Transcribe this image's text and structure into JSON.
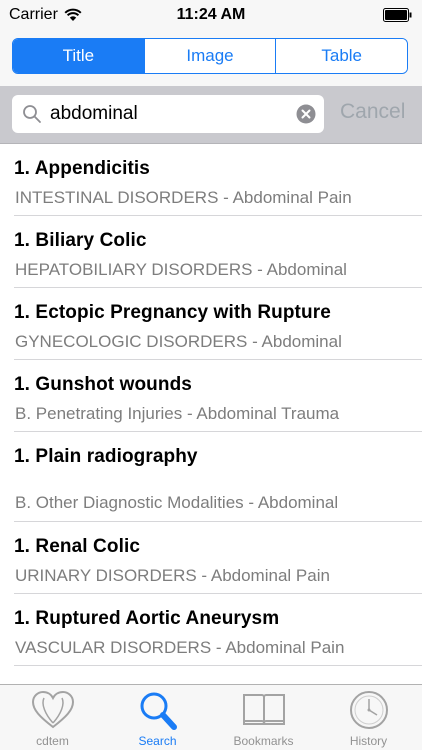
{
  "status_bar": {
    "carrier": "Carrier",
    "time": "11:24 AM"
  },
  "segments": {
    "title": "Title",
    "image": "Image",
    "table": "Table",
    "selected": "Title"
  },
  "search": {
    "query": "abdominal",
    "cancel_label": "Cancel"
  },
  "results": [
    {
      "title": "1. Appendicitis",
      "subtitle": "INTESTINAL DISORDERS - Abdominal Pain"
    },
    {
      "title": "1. Biliary Colic",
      "subtitle": "HEPATOBILIARY DISORDERS - Abdominal"
    },
    {
      "title": "1. Ectopic Pregnancy with Rupture",
      "subtitle": "GYNECOLOGIC DISORDERS - Abdominal"
    },
    {
      "title": "1. Gunshot wounds",
      "subtitle": "B. Penetrating Injuries - Abdominal Trauma"
    },
    {
      "title": "1. Plain radiography",
      "subtitle": "B. Other Diagnostic Modalities - Abdominal"
    },
    {
      "title": "1. Renal Colic",
      "subtitle": "URINARY DISORDERS - Abdominal Pain"
    },
    {
      "title": "1. Ruptured Aortic Aneurysm",
      "subtitle": "VASCULAR DISORDERS - Abdominal Pain"
    }
  ],
  "tabbar": {
    "cdtem": "cdtem",
    "search": "Search",
    "bookmarks": "Bookmarks",
    "history": "History",
    "active": "Search"
  },
  "colors": {
    "accent": "#1a7cf5",
    "subtitle": "#7d7d7d",
    "cancel": "#9fa6ad"
  },
  "icons": [
    "wifi-icon",
    "battery-icon",
    "search-icon",
    "clear-icon",
    "heart-icon",
    "magnifier-icon",
    "book-icon",
    "clock-icon"
  ]
}
